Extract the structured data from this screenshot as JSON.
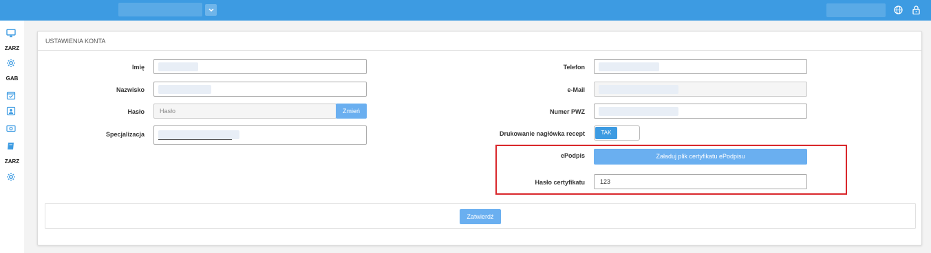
{
  "topbar": {
    "dropdown_icon": "chevron-down-icon",
    "globe_icon": "globe-icon",
    "lock_icon": "lock-icon"
  },
  "sidebar": {
    "items": [
      {
        "icon": "monitor-icon"
      },
      {
        "label": "ZARZ"
      },
      {
        "icon": "gear-icon"
      },
      {
        "label": "GAB"
      },
      {
        "icon": "calendar-check-icon"
      },
      {
        "icon": "contact-card-icon"
      },
      {
        "icon": "camera-icon"
      },
      {
        "icon": "book-icon"
      },
      {
        "label": "ZARZ"
      },
      {
        "icon": "gear-icon"
      }
    ]
  },
  "panel": {
    "title": "USTAWIENIA KONTA"
  },
  "form": {
    "imie_label": "Imię",
    "nazwisko_label": "Nazwisko",
    "haslo_label": "Hasło",
    "haslo_placeholder": "Hasło",
    "zmien_button": "Zmień",
    "specjalizacja_label": "Specjalizacja",
    "telefon_label": "Telefon",
    "email_label": "e-Mail",
    "pwz_label": "Numer PWZ",
    "naglowek_label": "Drukowanie nagłówka recept",
    "naglowek_toggle": "TAK",
    "epodpis_label": "ePodpis",
    "epodpis_button": "Załaduj plik certyfikatu ePodpisu",
    "haslo_cert_label": "Hasło certyfikatu",
    "haslo_cert_value": "123",
    "submit_button": "Zatwierdź"
  },
  "colors": {
    "accent": "#3d9be2",
    "button": "#6aaff0",
    "highlight": "#d9262a"
  }
}
